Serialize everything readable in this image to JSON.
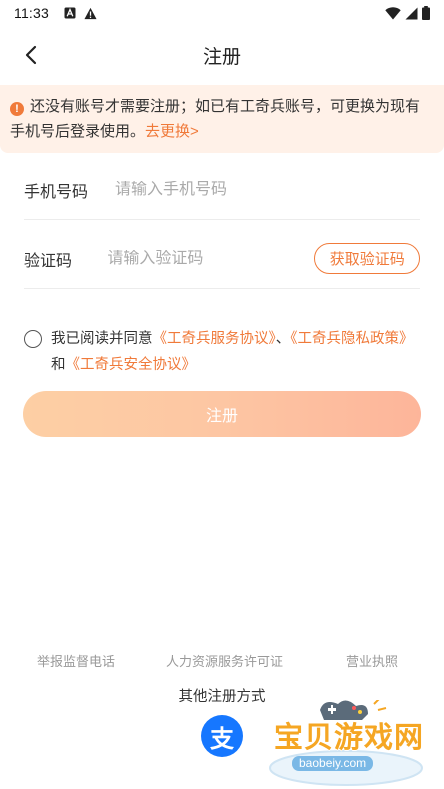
{
  "status_bar": {
    "time": "11:33"
  },
  "header": {
    "title": "注册"
  },
  "notice": {
    "text": "还没有账号才需要注册；如已有工奇兵账号，可更换为现有手机号后登录使用。",
    "link": "去更换>"
  },
  "form": {
    "phone": {
      "label": "手机号码",
      "placeholder": "请输入手机号码"
    },
    "code": {
      "label": "验证码",
      "placeholder": "请输入验证码",
      "button": "获取验证码"
    }
  },
  "agreement": {
    "prefix": "我已阅读并同意",
    "service": "《工奇兵服务协议》",
    "sep": "、",
    "privacy": "《工奇兵隐私政策》",
    "and": "和",
    "security": "《工奇兵安全协议》"
  },
  "register_button": "注册",
  "footer": {
    "links": [
      "举报监督电话",
      "人力资源服务许可证",
      "营业执照"
    ],
    "other_title": "其他注册方式",
    "alipay_glyph": "支"
  },
  "watermark": {
    "text": "宝贝游戏网",
    "url": "baobeiy.com"
  },
  "colors": {
    "accent": "#f07a3a",
    "notice_bg": "#fff1e8",
    "alipay": "#1677ff"
  }
}
